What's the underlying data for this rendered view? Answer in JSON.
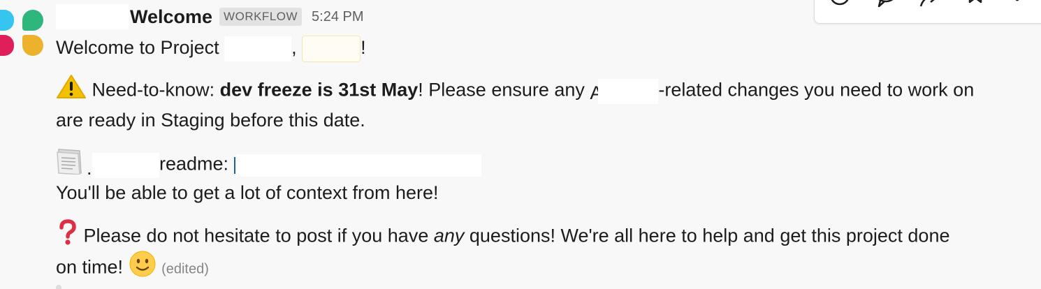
{
  "message": {
    "sender": "Welcome",
    "badge": "WORKFLOW",
    "timestamp": "5:24 PM",
    "welcome": {
      "prefix": "Welcome to Project ",
      "comma": ", ",
      "suffix": "!"
    },
    "notice": {
      "prefix": " Need-to-know: ",
      "bold": "dev freeze is 31st May",
      "middle": "! Please ensure any ",
      "redacted_initial": "A",
      "after": "-related changes you need to work on",
      "line2": "are ready in Staging before this date."
    },
    "readme": {
      "lead": ".",
      "label": "readme: ",
      "context_line": "You'll be able to get a lot of context from here!"
    },
    "questions": {
      "prefix": " Please do not hesitate to post if you have ",
      "emphasis": "any",
      "suffix": " questions! We're all here to help and get this project done",
      "line2": "on time! "
    },
    "edited": "(edited)"
  },
  "icons": {
    "avatar": "workflow-app-icon",
    "warning": "warning-icon",
    "page": "page-icon",
    "question": "question-mark-icon",
    "smile": "slightly-smiling-face-icon",
    "toolbar": [
      "emoji-reaction-icon",
      "reply-thread-icon",
      "share-icon",
      "bookmark-icon",
      "more-actions-icon"
    ]
  },
  "colors": {
    "background": "#f8f8f8",
    "text": "#1d1c1d",
    "muted": "#616061",
    "link": "#1264a3",
    "warning": "#f2c200",
    "question": "#dd2e44"
  }
}
